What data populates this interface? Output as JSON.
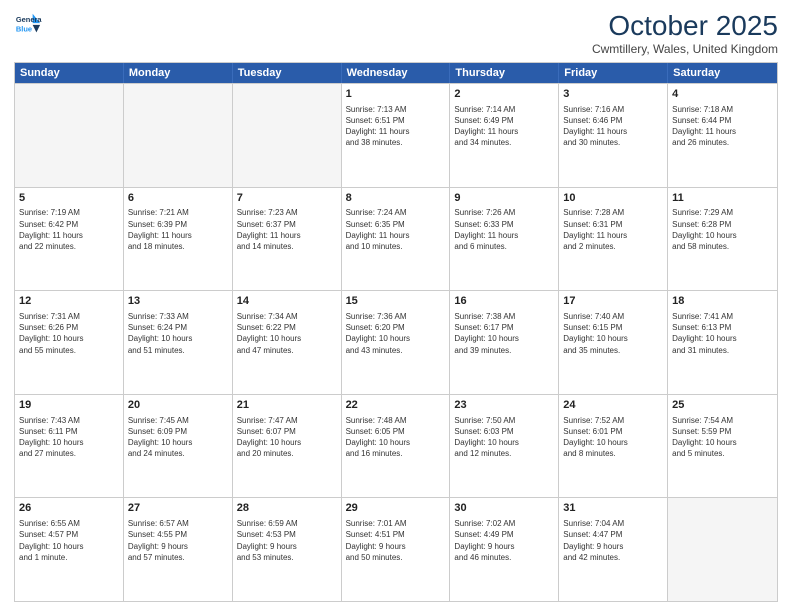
{
  "header": {
    "logo_line1": "General",
    "logo_line2": "Blue",
    "month": "October 2025",
    "location": "Cwmtillery, Wales, United Kingdom"
  },
  "days_of_week": [
    "Sunday",
    "Monday",
    "Tuesday",
    "Wednesday",
    "Thursday",
    "Friday",
    "Saturday"
  ],
  "weeks": [
    [
      {
        "day": "",
        "info": "",
        "empty": true
      },
      {
        "day": "",
        "info": "",
        "empty": true
      },
      {
        "day": "",
        "info": "",
        "empty": true
      },
      {
        "day": "1",
        "info": "Sunrise: 7:13 AM\nSunset: 6:51 PM\nDaylight: 11 hours\nand 38 minutes.",
        "empty": false
      },
      {
        "day": "2",
        "info": "Sunrise: 7:14 AM\nSunset: 6:49 PM\nDaylight: 11 hours\nand 34 minutes.",
        "empty": false
      },
      {
        "day": "3",
        "info": "Sunrise: 7:16 AM\nSunset: 6:46 PM\nDaylight: 11 hours\nand 30 minutes.",
        "empty": false
      },
      {
        "day": "4",
        "info": "Sunrise: 7:18 AM\nSunset: 6:44 PM\nDaylight: 11 hours\nand 26 minutes.",
        "empty": false
      }
    ],
    [
      {
        "day": "5",
        "info": "Sunrise: 7:19 AM\nSunset: 6:42 PM\nDaylight: 11 hours\nand 22 minutes.",
        "empty": false
      },
      {
        "day": "6",
        "info": "Sunrise: 7:21 AM\nSunset: 6:39 PM\nDaylight: 11 hours\nand 18 minutes.",
        "empty": false
      },
      {
        "day": "7",
        "info": "Sunrise: 7:23 AM\nSunset: 6:37 PM\nDaylight: 11 hours\nand 14 minutes.",
        "empty": false
      },
      {
        "day": "8",
        "info": "Sunrise: 7:24 AM\nSunset: 6:35 PM\nDaylight: 11 hours\nand 10 minutes.",
        "empty": false
      },
      {
        "day": "9",
        "info": "Sunrise: 7:26 AM\nSunset: 6:33 PM\nDaylight: 11 hours\nand 6 minutes.",
        "empty": false
      },
      {
        "day": "10",
        "info": "Sunrise: 7:28 AM\nSunset: 6:31 PM\nDaylight: 11 hours\nand 2 minutes.",
        "empty": false
      },
      {
        "day": "11",
        "info": "Sunrise: 7:29 AM\nSunset: 6:28 PM\nDaylight: 10 hours\nand 58 minutes.",
        "empty": false
      }
    ],
    [
      {
        "day": "12",
        "info": "Sunrise: 7:31 AM\nSunset: 6:26 PM\nDaylight: 10 hours\nand 55 minutes.",
        "empty": false
      },
      {
        "day": "13",
        "info": "Sunrise: 7:33 AM\nSunset: 6:24 PM\nDaylight: 10 hours\nand 51 minutes.",
        "empty": false
      },
      {
        "day": "14",
        "info": "Sunrise: 7:34 AM\nSunset: 6:22 PM\nDaylight: 10 hours\nand 47 minutes.",
        "empty": false
      },
      {
        "day": "15",
        "info": "Sunrise: 7:36 AM\nSunset: 6:20 PM\nDaylight: 10 hours\nand 43 minutes.",
        "empty": false
      },
      {
        "day": "16",
        "info": "Sunrise: 7:38 AM\nSunset: 6:17 PM\nDaylight: 10 hours\nand 39 minutes.",
        "empty": false
      },
      {
        "day": "17",
        "info": "Sunrise: 7:40 AM\nSunset: 6:15 PM\nDaylight: 10 hours\nand 35 minutes.",
        "empty": false
      },
      {
        "day": "18",
        "info": "Sunrise: 7:41 AM\nSunset: 6:13 PM\nDaylight: 10 hours\nand 31 minutes.",
        "empty": false
      }
    ],
    [
      {
        "day": "19",
        "info": "Sunrise: 7:43 AM\nSunset: 6:11 PM\nDaylight: 10 hours\nand 27 minutes.",
        "empty": false
      },
      {
        "day": "20",
        "info": "Sunrise: 7:45 AM\nSunset: 6:09 PM\nDaylight: 10 hours\nand 24 minutes.",
        "empty": false
      },
      {
        "day": "21",
        "info": "Sunrise: 7:47 AM\nSunset: 6:07 PM\nDaylight: 10 hours\nand 20 minutes.",
        "empty": false
      },
      {
        "day": "22",
        "info": "Sunrise: 7:48 AM\nSunset: 6:05 PM\nDaylight: 10 hours\nand 16 minutes.",
        "empty": false
      },
      {
        "day": "23",
        "info": "Sunrise: 7:50 AM\nSunset: 6:03 PM\nDaylight: 10 hours\nand 12 minutes.",
        "empty": false
      },
      {
        "day": "24",
        "info": "Sunrise: 7:52 AM\nSunset: 6:01 PM\nDaylight: 10 hours\nand 8 minutes.",
        "empty": false
      },
      {
        "day": "25",
        "info": "Sunrise: 7:54 AM\nSunset: 5:59 PM\nDaylight: 10 hours\nand 5 minutes.",
        "empty": false
      }
    ],
    [
      {
        "day": "26",
        "info": "Sunrise: 6:55 AM\nSunset: 4:57 PM\nDaylight: 10 hours\nand 1 minute.",
        "empty": false
      },
      {
        "day": "27",
        "info": "Sunrise: 6:57 AM\nSunset: 4:55 PM\nDaylight: 9 hours\nand 57 minutes.",
        "empty": false
      },
      {
        "day": "28",
        "info": "Sunrise: 6:59 AM\nSunset: 4:53 PM\nDaylight: 9 hours\nand 53 minutes.",
        "empty": false
      },
      {
        "day": "29",
        "info": "Sunrise: 7:01 AM\nSunset: 4:51 PM\nDaylight: 9 hours\nand 50 minutes.",
        "empty": false
      },
      {
        "day": "30",
        "info": "Sunrise: 7:02 AM\nSunset: 4:49 PM\nDaylight: 9 hours\nand 46 minutes.",
        "empty": false
      },
      {
        "day": "31",
        "info": "Sunrise: 7:04 AM\nSunset: 4:47 PM\nDaylight: 9 hours\nand 42 minutes.",
        "empty": false
      },
      {
        "day": "",
        "info": "",
        "empty": true
      }
    ]
  ]
}
